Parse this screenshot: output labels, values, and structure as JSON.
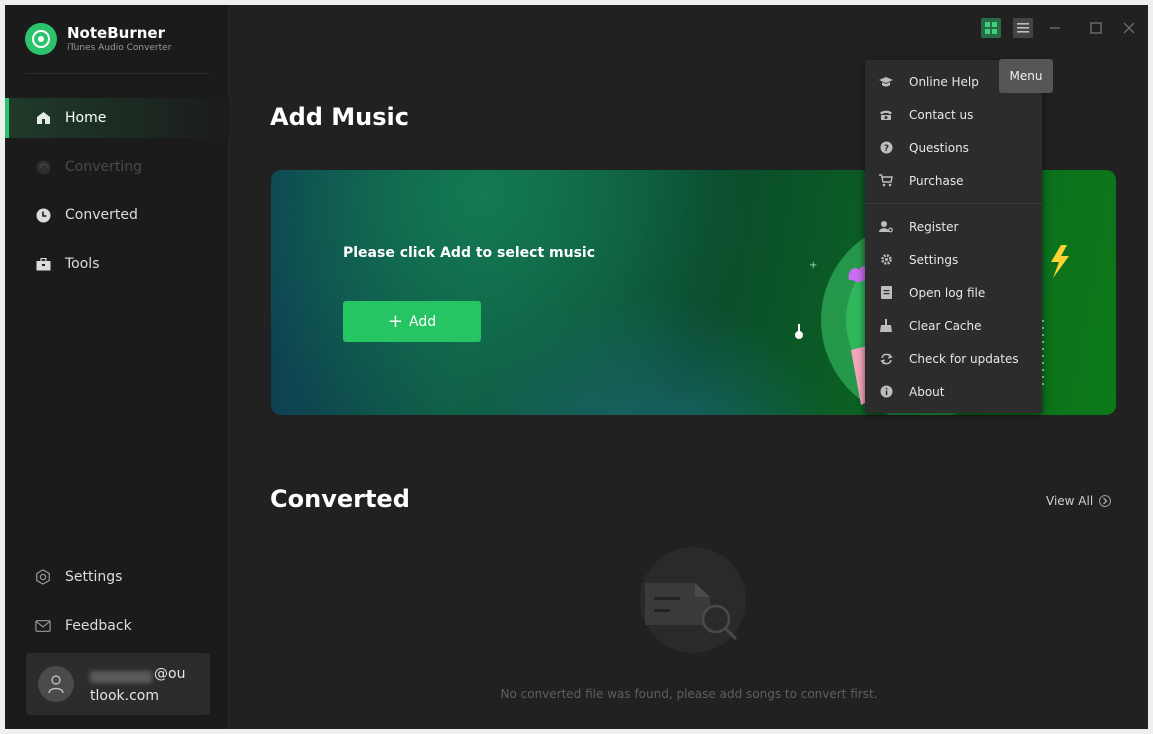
{
  "app": {
    "name": "NoteBurner",
    "subtitle": "iTunes Audio Converter"
  },
  "sidebar": {
    "items": [
      {
        "label": "Home",
        "icon": "home-icon",
        "state": "active"
      },
      {
        "label": "Converting",
        "icon": "converting-icon",
        "state": "disabled"
      },
      {
        "label": "Converted",
        "icon": "clock-icon",
        "state": "normal"
      },
      {
        "label": "Tools",
        "icon": "toolbox-icon",
        "state": "normal"
      }
    ],
    "bottom": [
      {
        "label": "Settings",
        "icon": "settings-icon"
      },
      {
        "label": "Feedback",
        "icon": "mail-icon"
      }
    ],
    "user": {
      "email_line1": "@ou",
      "email_line2": "tlook.com"
    }
  },
  "main": {
    "add_title": "Add Music",
    "banner_prompt": "Please click Add to select music",
    "add_button": "Add",
    "converted_title": "Converted",
    "view_all": "View All",
    "empty_text": "No converted file was found, please add songs to convert first."
  },
  "titlebar": {
    "menu_tooltip": "Menu"
  },
  "menu": {
    "items": [
      {
        "label": "Online Help",
        "icon": "graduation-cap-icon"
      },
      {
        "label": "Contact us",
        "icon": "phone-icon"
      },
      {
        "label": "Questions",
        "icon": "question-icon"
      },
      {
        "label": "Purchase",
        "icon": "cart-icon"
      },
      {
        "label": "Register",
        "icon": "key-user-icon"
      },
      {
        "label": "Settings",
        "icon": "gear-icon"
      },
      {
        "label": "Open log file",
        "icon": "file-icon"
      },
      {
        "label": "Clear Cache",
        "icon": "broom-icon"
      },
      {
        "label": "Check for updates",
        "icon": "refresh-icon"
      },
      {
        "label": "About",
        "icon": "info-icon"
      }
    ]
  },
  "colors": {
    "accent": "#27c463",
    "background": "#212121",
    "sidebar": "#1b1b1b",
    "menu": "#2c2c2c"
  }
}
